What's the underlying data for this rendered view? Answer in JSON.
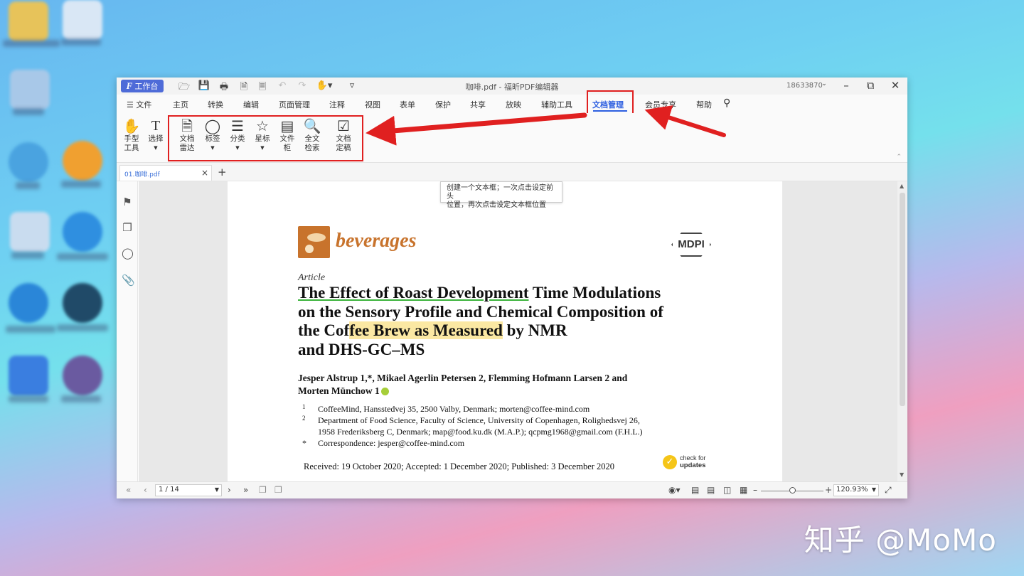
{
  "app": {
    "workbench_label": "工作台",
    "window_title": "咖啡.pdf - 福昕PDF编辑器",
    "user_id": "18633870"
  },
  "menu": {
    "file": "文件",
    "items": [
      "主页",
      "转换",
      "编辑",
      "页面管理",
      "注释",
      "视图",
      "表单",
      "保护",
      "共享",
      "放映",
      "辅助工具",
      "文档管理",
      "会员专享",
      "帮助"
    ],
    "active": "文档管理"
  },
  "ribbon": {
    "hand_tool": "手型\n工具",
    "select": "选择",
    "doc_radar": "文档\n雷达",
    "tags": "标签",
    "categories": "分类",
    "star": "星标",
    "file_cabinet": "文件\n柜",
    "fulltext_search": "全文\n检索",
    "doc_finalize": "文档\n定稿"
  },
  "tabs": {
    "doc_tab": "01.咖啡.pdf"
  },
  "tooltip": {
    "line1": "创建一个文本框；一次点击设定前头",
    "line2": "位置，再次点击设定文本框位置"
  },
  "paper": {
    "journal": "beverages",
    "publisher": "MDPI",
    "type": "Article",
    "title_line1_ul": "The Effect of Roast Development",
    "title_line1_rest": " Time Modulations",
    "title_line2": "on the Sensory Profile and Chemical Composition of",
    "title_line3_a": "the Cof",
    "title_line3_hl": "fee Brew as Measured",
    "title_line3_b": " by NMR",
    "title_line4": "and DHS-GC–MS",
    "authors_line1": "Jesper Alstrup 1,*, Mikael Agerlin Petersen 2, Flemming Hofmann Larsen 2 and",
    "authors_line2": "Morten Münchow 1",
    "affiliations": [
      {
        "num": "1",
        "text": "CoffeeMind, Hansstedvej 35, 2500 Valby, Denmark; morten@coffee-mind.com"
      },
      {
        "num": "2",
        "text": "Department of Food Science, Faculty of Science, University of Copenhagen, Rolighedsvej 26,"
      },
      {
        "num": "",
        "text": "1958 Frederiksberg C, Denmark; map@food.ku.dk (M.A.P.); qcpmg1968@gmail.com (F.H.L.)"
      },
      {
        "num": "*",
        "text": "Correspondence: jesper@coffee-mind.com"
      }
    ],
    "received": "Received: 19 October 2020; Accepted: 1 December 2020; Published: 3 December 2020",
    "check_line1": "check for",
    "check_line2": "updates"
  },
  "status": {
    "page": "1 / 14",
    "zoom": "120.93%"
  },
  "watermark": "知乎 @MoMo",
  "colors": {
    "accent": "#2d5fe0",
    "highlight_red": "#e02020",
    "journal_brand": "#c8732c"
  }
}
